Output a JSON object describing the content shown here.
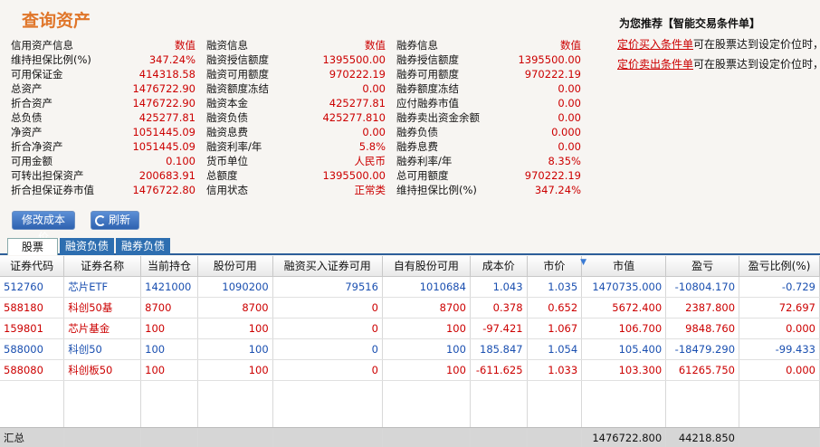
{
  "page": {
    "title": "查询资产"
  },
  "info": {
    "headers": [
      "信用资产信息",
      "数值",
      "融资信息",
      "数值",
      "融券信息",
      "数值"
    ],
    "rows": [
      [
        "维持担保比例(%)",
        "347.24%",
        "融资授信额度",
        "1395500.00",
        "融券授信额度",
        "1395500.00"
      ],
      [
        "可用保证金",
        "414318.58",
        "融资可用额度",
        "970222.19",
        "融券可用额度",
        "970222.19"
      ],
      [
        "总资产",
        "1476722.90",
        "融资额度冻结",
        "0.00",
        "融券额度冻结",
        "0.00"
      ],
      [
        "折合资产",
        "1476722.90",
        "融资本金",
        "425277.81",
        "应付融券市值",
        "0.00"
      ],
      [
        "总负债",
        "425277.81",
        "融资负债",
        "425277.810",
        "融券卖出资金余额",
        "0.00"
      ],
      [
        "净资产",
        "1051445.09",
        "融资息费",
        "0.00",
        "融券负债",
        "0.000"
      ],
      [
        "折合净资产",
        "1051445.09",
        "融资利率/年",
        "5.8%",
        "融券息费",
        "0.00"
      ],
      [
        "可用金额",
        "0.100",
        "货币单位",
        "人民币",
        "融券利率/年",
        "8.35%"
      ],
      [
        "可转出担保资产",
        "200683.91",
        "总额度",
        "1395500.00",
        "总可用额度",
        "970222.19"
      ],
      [
        "折合担保证券市值",
        "1476722.80",
        "信用状态",
        "正常类",
        "维持担保比例(%)",
        "347.24%"
      ]
    ]
  },
  "recommend": {
    "title": "为您推荐【智能交易条件单】",
    "lines": [
      {
        "link": "定价买入条件单",
        "text": "可在股票达到设定价位时，"
      },
      {
        "link": "定价卖出条件单",
        "text": "可在股票达到设定价位时，"
      }
    ]
  },
  "buttons": {
    "modify": "修改成本价",
    "refresh": "刷新"
  },
  "tabs": [
    "股票",
    "融资负债",
    "融券负债"
  ],
  "table": {
    "columns": [
      "证券代码",
      "证券名称",
      "当前持仓",
      "股份可用",
      "融资买入证券可用",
      "自有股份可用",
      "成本价",
      "市价",
      "市值",
      "盈亏",
      "盈亏比例(%)"
    ],
    "rows": [
      {
        "color": "blue",
        "cells": [
          "512760",
          "芯片ETF",
          "1421000",
          "1090200",
          "79516",
          "1010684",
          "1.043",
          "1.035",
          "1470735.000",
          "-10804.170",
          "-0.729"
        ]
      },
      {
        "color": "red",
        "cells": [
          "588180",
          "科创50基",
          "8700",
          "8700",
          "0",
          "8700",
          "0.378",
          "0.652",
          "5672.400",
          "2387.800",
          "72.697"
        ]
      },
      {
        "color": "red",
        "cells": [
          "159801",
          "芯片基金",
          "100",
          "100",
          "0",
          "100",
          "-97.421",
          "1.067",
          "106.700",
          "9848.760",
          "0.000"
        ]
      },
      {
        "color": "blue",
        "cells": [
          "588000",
          "科创50",
          "100",
          "100",
          "0",
          "100",
          "185.847",
          "1.054",
          "105.400",
          "-18479.290",
          "-99.433"
        ]
      },
      {
        "color": "red",
        "cells": [
          "588080",
          "科创板50",
          "100",
          "100",
          "0",
          "100",
          "-611.625",
          "1.033",
          "103.300",
          "61265.750",
          "0.000"
        ]
      }
    ],
    "footer": {
      "label": "汇总",
      "market_value": "1476722.800",
      "profit": "44218.850"
    }
  }
}
